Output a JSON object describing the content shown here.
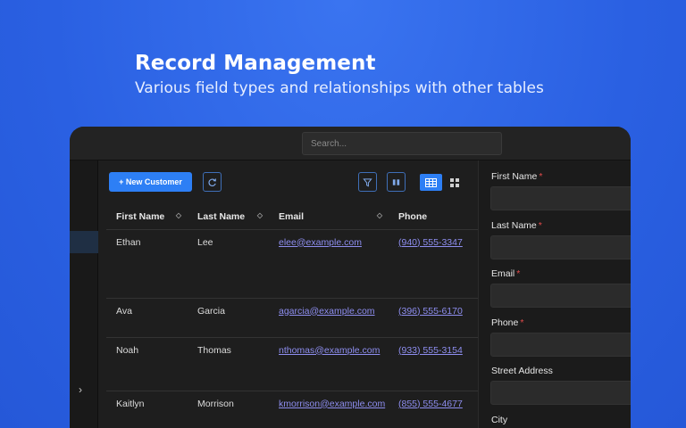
{
  "hero": {
    "title": "Record Management",
    "subtitle": "Various field types and relationships with other tables"
  },
  "topbar": {
    "search_placeholder": "Search..."
  },
  "toolbar": {
    "new_label": "+ New Customer",
    "refresh_icon": "refresh-icon",
    "filter_icon": "filter-icon",
    "columns_icon": "columns-icon",
    "table_view_icon": "table-view-icon",
    "grid_view_icon": "grid-view-icon"
  },
  "table": {
    "columns": [
      "First Name",
      "Last Name",
      "Email",
      "Phone"
    ],
    "rows": [
      {
        "first": "Ethan",
        "last": "Lee",
        "email": "elee@example.com",
        "phone": "(940) 555-3347"
      },
      {
        "first": "Ava",
        "last": "Garcia",
        "email": "agarcia@example.com",
        "phone": "(396) 555-6170"
      },
      {
        "first": "Noah",
        "last": "Thomas",
        "email": "nthomas@example.com",
        "phone": "(933) 555-3154"
      },
      {
        "first": "Kaitlyn",
        "last": "Morrison",
        "email": "kmorrison@example.com",
        "phone": "(855) 555-4677"
      }
    ]
  },
  "form": {
    "fields": [
      {
        "label": "First Name",
        "required": "*"
      },
      {
        "label": "Last Name",
        "required": "*"
      },
      {
        "label": "Email",
        "required": "*"
      },
      {
        "label": "Phone",
        "required": "*"
      },
      {
        "label": "Street Address",
        "required": ""
      },
      {
        "label": "City",
        "required": ""
      }
    ]
  },
  "colors": {
    "background": "#2a60e2",
    "accent": "#2d7ff5",
    "link": "#8e8ef0",
    "required": "#e24b4b"
  }
}
